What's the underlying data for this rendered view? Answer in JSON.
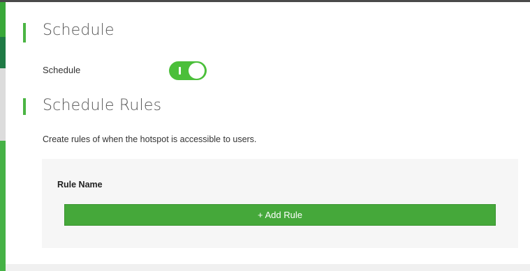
{
  "schedule_section": {
    "title": "Schedule",
    "toggle_label": "Schedule",
    "toggle_state": "on"
  },
  "rules_section": {
    "title": "Schedule Rules",
    "description": "Create rules of when the hotspot is accessible to users.",
    "table": {
      "columns": [
        "Rule Name"
      ]
    },
    "add_button_label": "+ Add Rule"
  },
  "colors": {
    "accent": "#4bb543",
    "button": "#45a83a",
    "toggle_on": "#4bbf3a"
  }
}
